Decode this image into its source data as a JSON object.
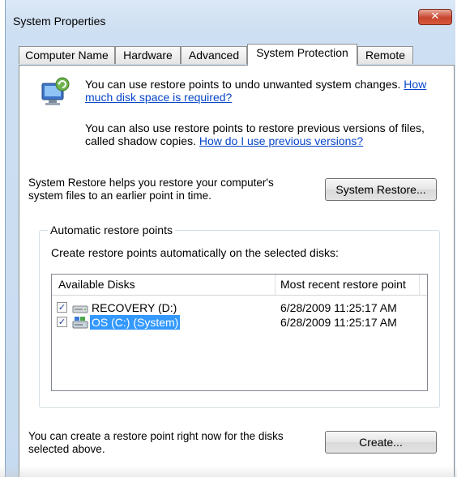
{
  "window": {
    "title": "System Properties",
    "close_label": "✕"
  },
  "tabs": [
    {
      "label": "Computer Name"
    },
    {
      "label": "Hardware"
    },
    {
      "label": "Advanced"
    },
    {
      "label": "System Protection"
    },
    {
      "label": "Remote"
    }
  ],
  "active_tab": "System Protection",
  "intro": {
    "p1_text": "You can use restore points to undo unwanted system changes.",
    "p1_link": "How much disk space is required?",
    "p2_text": "You can also use restore points to restore previous versions of files, called shadow copies.",
    "p2_link": "How do I use previous versions?"
  },
  "system_restore": {
    "description": "System Restore helps you restore your computer's system files to an earlier point in time.",
    "button_label": "System Restore..."
  },
  "auto_restore": {
    "group_title": "Automatic restore points",
    "instruction": "Create restore points automatically on the selected disks:",
    "columns": [
      "Available Disks",
      "Most recent restore point"
    ],
    "disks": [
      {
        "name": "RECOVERY (D:)",
        "date": "6/28/2009 11:25:17 AM",
        "checked": true,
        "selected": false,
        "icon": "drive-icon"
      },
      {
        "name": "OS (C:) (System)",
        "date": "6/28/2009 11:25:17 AM",
        "checked": true,
        "selected": true,
        "icon": "system-drive-icon"
      }
    ]
  },
  "create": {
    "description": "You can create a restore point right now for the disks selected above.",
    "button_label": "Create..."
  },
  "colors": {
    "link": "#0645c8",
    "selection": "#3399ff",
    "close_button": "#c7452e"
  }
}
